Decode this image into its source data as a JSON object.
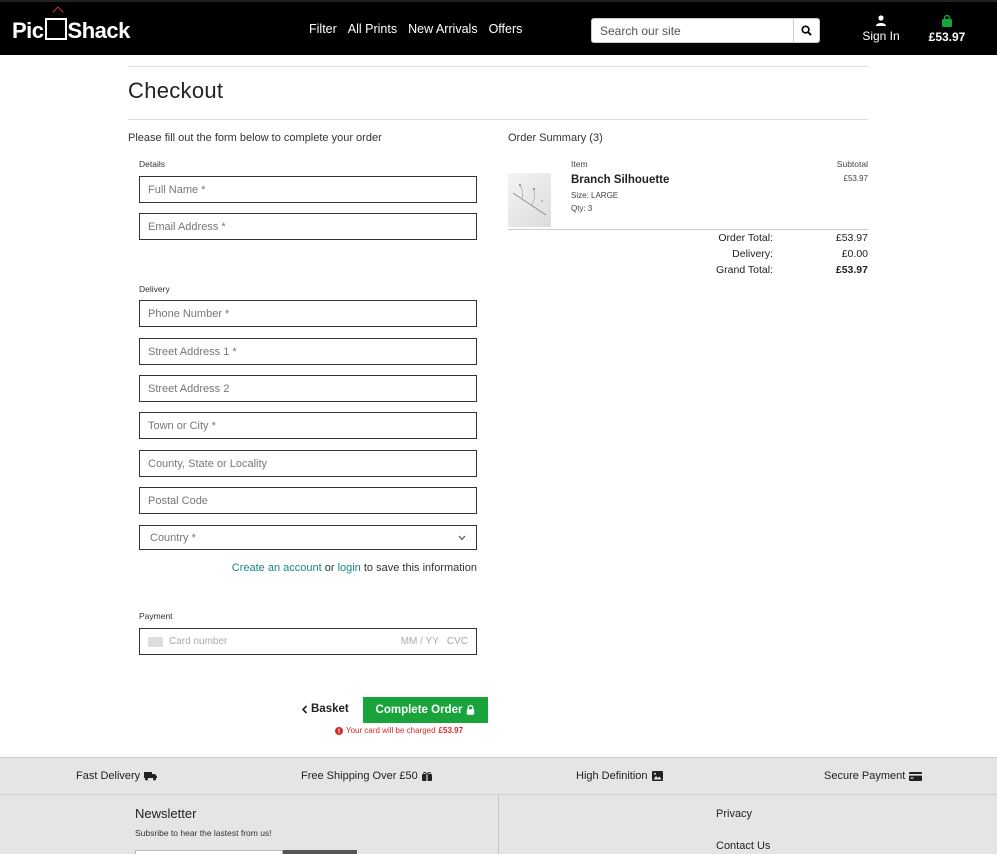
{
  "header": {
    "logo_text_left": "Pic",
    "logo_text_right": "Shack",
    "nav": [
      "Filter",
      "All Prints",
      "New Arrivals",
      "Offers"
    ],
    "search_placeholder": "Search our site",
    "signin_label": "Sign In",
    "cart_total": "£53.97",
    "icons": {
      "search": "search-icon",
      "user": "user-icon",
      "bag": "shopping-bag-icon"
    },
    "colors": {
      "bar": "#000000",
      "bag": "#18a33b"
    }
  },
  "page": {
    "title": "Checkout"
  },
  "form": {
    "intro": "Please fill out the form below to complete your order",
    "details_label": "Details",
    "details_fields": [
      "Full Name *",
      "Email Address *"
    ],
    "delivery_label": "Delivery",
    "delivery_fields": [
      "Phone Number *",
      "Street Address 1 *",
      "Street Address 2",
      "Town or City *",
      "County, State or Locality",
      "Postal Code"
    ],
    "country_placeholder": "Country *",
    "account": {
      "create_link": "Create an account",
      "or_text": "or",
      "login_link": "login",
      "suffix": "to save this information"
    },
    "payment_label": "Payment",
    "card": {
      "number_placeholder": "Card number",
      "expiry_placeholder": "MM / YY",
      "cvc_placeholder": "CVC"
    },
    "basket_link": "Basket",
    "complete_button": "Complete Order",
    "charge_note_prefix": "Your card will be charged",
    "charge_amount": "£53.97",
    "colors": {
      "button": "#18a33b",
      "link": "#17868f",
      "warning": "#d72a2a"
    }
  },
  "summary": {
    "title": "Order Summary (3)",
    "col_item": "Item",
    "col_subtotal": "Subtotal",
    "item": {
      "name": "Branch Silhouette",
      "size": "Size: LARGE",
      "qty": "Qty: 3",
      "subtotal": "£53.97"
    },
    "totals": [
      {
        "label": "Order Total:",
        "value": "£53.97"
      },
      {
        "label": "Delivery:",
        "value": "£0.00"
      },
      {
        "label": "Grand Total:",
        "value": "£53.97"
      }
    ]
  },
  "features": [
    {
      "label": "Fast Delivery",
      "icon": "truck-icon"
    },
    {
      "label": "Free Shipping Over £50",
      "icon": "gift-icon"
    },
    {
      "label": "High Definition",
      "icon": "image-icon"
    },
    {
      "label": "Secure Payment",
      "icon": "credit-card-icon"
    }
  ],
  "footer": {
    "newsletter_title": "Newsletter",
    "newsletter_sub": "Subsribe to hear the lastest from us!",
    "links": [
      "Privacy",
      "Contact Us"
    ]
  }
}
